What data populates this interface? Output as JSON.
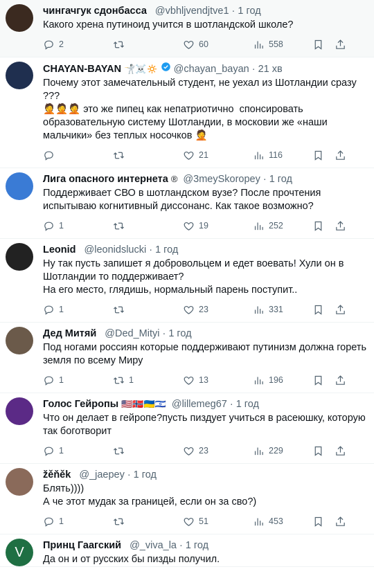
{
  "tweets": [
    {
      "name": "чингачгук сдонбасса",
      "handle": "@vbhljvendjtve1",
      "time": "1 год",
      "badges": "",
      "text": "Какого хрена путиноид учится в шотландской школе?",
      "replies": "2",
      "retweets": "",
      "likes": "60",
      "views": "558",
      "verified": false,
      "avatar_color": "#3b2a20",
      "avatar_letter": ""
    },
    {
      "name": "CHAYAN-BAYAN",
      "handle": "@chayan_bayan",
      "time": "21 хв",
      "badges": "🤺☠️🔅",
      "text": "Почему этот замечательный студент, не уехал из Шотландии сразу ???\n🤦🤦🤦 это же пипец как непатриотично  спонсировать образовательную систему Шотландии, в московии же «наши мальчики» без теплых носочков 🤦",
      "replies": "",
      "retweets": "",
      "likes": "21",
      "views": "116",
      "verified": true,
      "avatar_color": "#1f2f4f",
      "avatar_letter": ""
    },
    {
      "name": "Лига опасного интернета",
      "handle": "@3meySkoropey",
      "time": "1 год",
      "badges": "®",
      "text": "Поддерживает СВО в шотландском вузе? После прочтения испытываю когнитивный диссонанс. Как такое возможно?",
      "replies": "1",
      "retweets": "",
      "likes": "19",
      "views": "252",
      "verified": false,
      "avatar_color": "#3a7bd5",
      "avatar_letter": ""
    },
    {
      "name": "Leonid",
      "handle": "@leonidslucki",
      "time": "1 год",
      "badges": "",
      "text": "Ну так пусть запишет я добровольцем и едет воевать! Хули он в Шотландии то поддерживает?\nНа его место, глядишь, нормальный парень поступит..",
      "replies": "1",
      "retweets": "",
      "likes": "23",
      "views": "331",
      "verified": false,
      "avatar_color": "#222222",
      "avatar_letter": ""
    },
    {
      "name": "Дед Митяй",
      "handle": "@Ded_Mityi",
      "time": "1 год",
      "badges": "",
      "text": "Под ногами россиян которые поддерживают путинизм должна гореть земля по всему Миру",
      "replies": "1",
      "retweets": "1",
      "likes": "13",
      "views": "196",
      "verified": false,
      "avatar_color": "#6b5a4a",
      "avatar_letter": ""
    },
    {
      "name": "Голос Гейропы",
      "handle": "@lillemeg67",
      "time": "1 год",
      "badges": "🇺🇸🇳🇴🇺🇦🇮🇱",
      "text": "Что он делает в гейропе?пусть пиздует учиться в расеюшку, которую так боготворит",
      "replies": "1",
      "retweets": "",
      "likes": "23",
      "views": "229",
      "verified": false,
      "avatar_color": "#5b2a86",
      "avatar_letter": ""
    },
    {
      "name": "žěňěk",
      "handle": "@_jaepey",
      "time": "1 год",
      "badges": "",
      "text": "Блять))))\nА че этот мудак за границей, если он за сво?)",
      "replies": "1",
      "retweets": "",
      "likes": "51",
      "views": "453",
      "verified": false,
      "avatar_color": "#8a6a5a",
      "avatar_letter": ""
    },
    {
      "name": "Принц Гаагский",
      "handle": "@_viva_la",
      "time": "1 год",
      "badges": "",
      "text": "Да он и от русских бы пизды получил.",
      "replies": "",
      "retweets": "",
      "likes": "",
      "views": "",
      "verified": false,
      "avatar_color": "#1f6f43",
      "avatar_letter": "V"
    }
  ],
  "colors": {
    "secondary_text": "#536471",
    "verified_blue": "#1d9bf0",
    "divider": "#eff3f4"
  },
  "icons": [
    "reply-icon",
    "retweet-icon",
    "like-icon",
    "views-icon",
    "bookmark-icon",
    "share-icon"
  ]
}
